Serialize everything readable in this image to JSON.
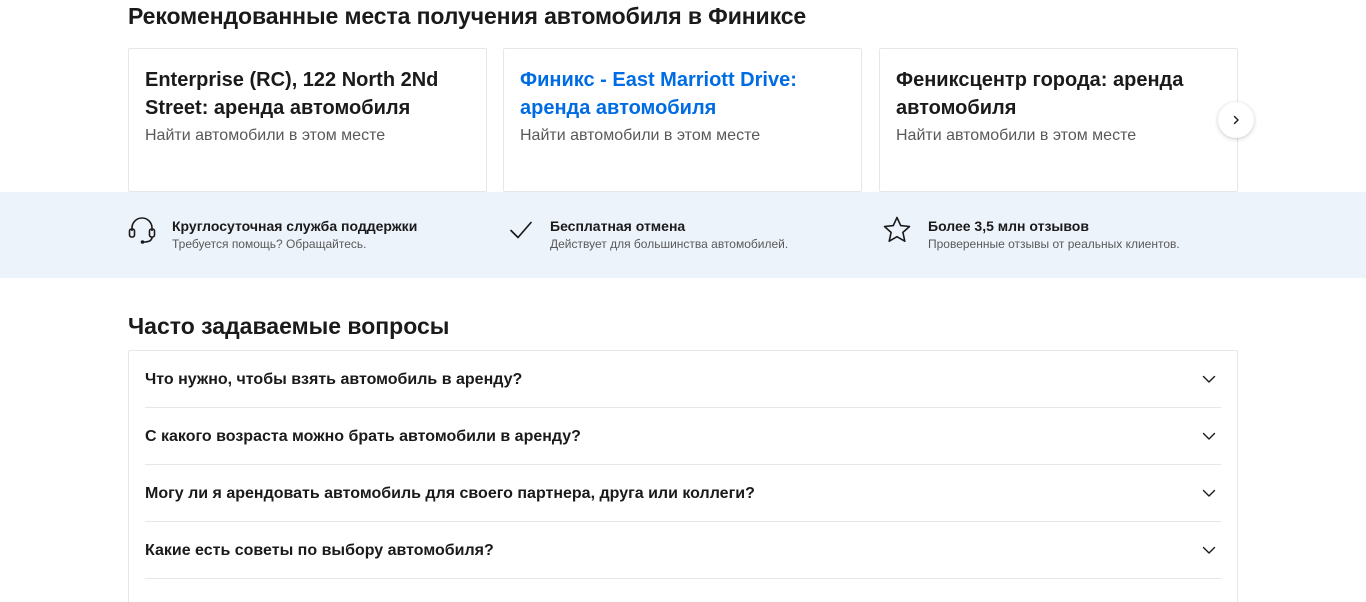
{
  "recommended": {
    "title": "Рекомендованные места получения автомобиля в Финиксе",
    "cards": [
      {
        "title": "Enterprise (RC), 122 North 2Nd Street: аренда автомобиля",
        "subtitle": "Найти автомобили в этом месте"
      },
      {
        "title": "Финикс - East Marriott Drive: аренда автомобиля",
        "subtitle": "Найти автомобили в этом месте"
      },
      {
        "title": "Фениксцентр города: аренда автомобиля",
        "subtitle": "Найти автомобили в этом месте"
      }
    ],
    "next_icon": "chevron-right-icon"
  },
  "benefits": [
    {
      "icon": "headset-icon",
      "title": "Круглосуточная служба поддержки",
      "subtitle": "Требуется помощь? Обращайтесь."
    },
    {
      "icon": "checkmark-icon",
      "title": "Бесплатная отмена",
      "subtitle": "Действует для большинства автомобилей."
    },
    {
      "icon": "star-icon",
      "title": "Более 3,5 млн отзывов",
      "subtitle": "Проверенные отзывы от реальных клиентов."
    }
  ],
  "faq": {
    "title": "Часто задаваемые вопросы",
    "items": [
      {
        "question": "Что нужно, чтобы взять автомобиль в аренду?"
      },
      {
        "question": "С какого возраста можно брать автомобили в аренду?"
      },
      {
        "question": "Могу ли я арендовать автомобиль для своего партнера, друга или коллеги?"
      },
      {
        "question": "Какие есть советы по выбору автомобиля?"
      }
    ]
  },
  "colors": {
    "link": "#006ce4",
    "band_background": "#edf3fb",
    "border": "#e7e7e7",
    "text_primary": "#1a1a1a",
    "text_secondary": "#595959"
  }
}
